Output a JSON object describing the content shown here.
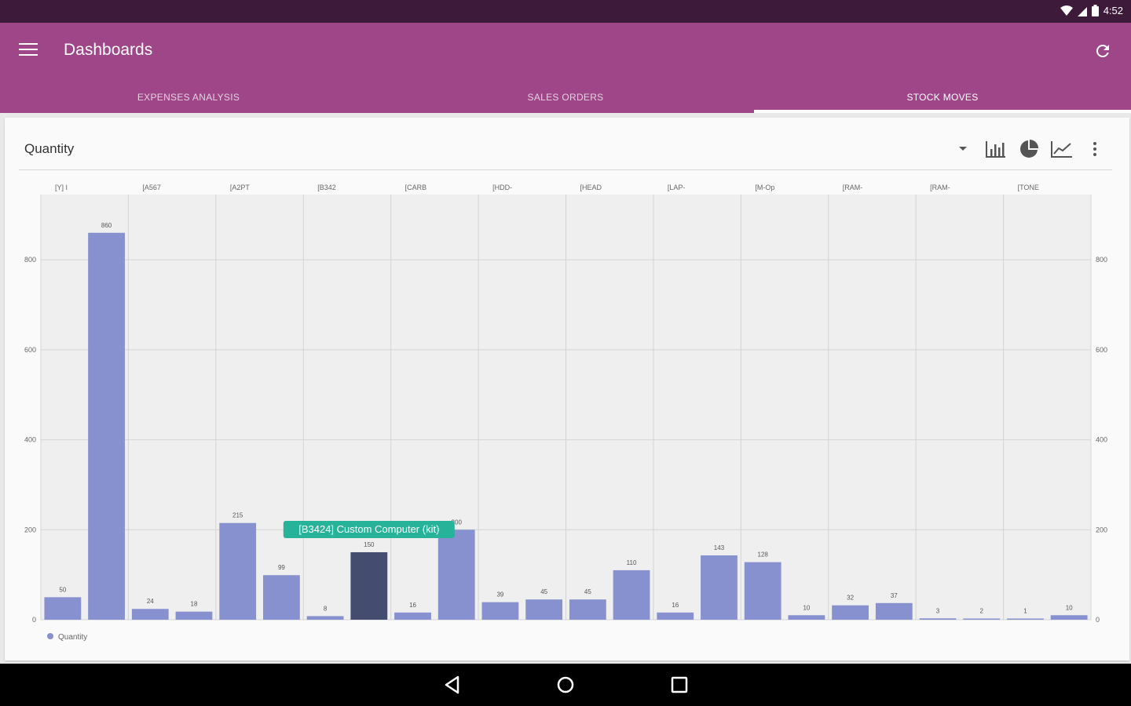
{
  "status_bar": {
    "time": "4:52"
  },
  "app_bar": {
    "title": "Dashboards"
  },
  "tabs": [
    {
      "label": "EXPENSES ANALYSIS",
      "active": false
    },
    {
      "label": "SALES ORDERS",
      "active": false
    },
    {
      "label": "STOCK MOVES",
      "active": true
    }
  ],
  "card": {
    "title": "Quantity"
  },
  "tooltip": {
    "text": "[B3424] Custom Computer (kit)"
  },
  "colors": {
    "bar": "#8891cf",
    "bar_selected": "#444d70",
    "tooltip": "#26b39a",
    "app_bar": "#9e4688",
    "status_bar": "#3d1a3a"
  },
  "chart_data": {
    "type": "bar",
    "categories_top": [
      "[Y] I",
      "[A567",
      "[A2PT",
      "[B342",
      "[CARB",
      "[HDD-",
      "[HEAD",
      "[LAP-",
      "[M-Op",
      "[RAM-",
      "[RAM-",
      "[TONE"
    ],
    "values": [
      50,
      860,
      24,
      18,
      215,
      99,
      8,
      150,
      16,
      200,
      39,
      45,
      45,
      110,
      16,
      143,
      128,
      10,
      32,
      37,
      3,
      2,
      1,
      10
    ],
    "value_labels": [
      "50",
      "860",
      "24",
      "18",
      "215",
      "99",
      "8",
      "150",
      "16",
      "200",
      "39",
      "45",
      "45",
      "110",
      "16",
      "143",
      "128",
      "10",
      "32",
      "37",
      "3",
      "2",
      "1",
      "10"
    ],
    "selected_index": 7,
    "y_ticks": [
      0,
      200,
      400,
      600,
      800
    ],
    "ylim": [
      0,
      945
    ],
    "legend": [
      "Quantity"
    ]
  }
}
